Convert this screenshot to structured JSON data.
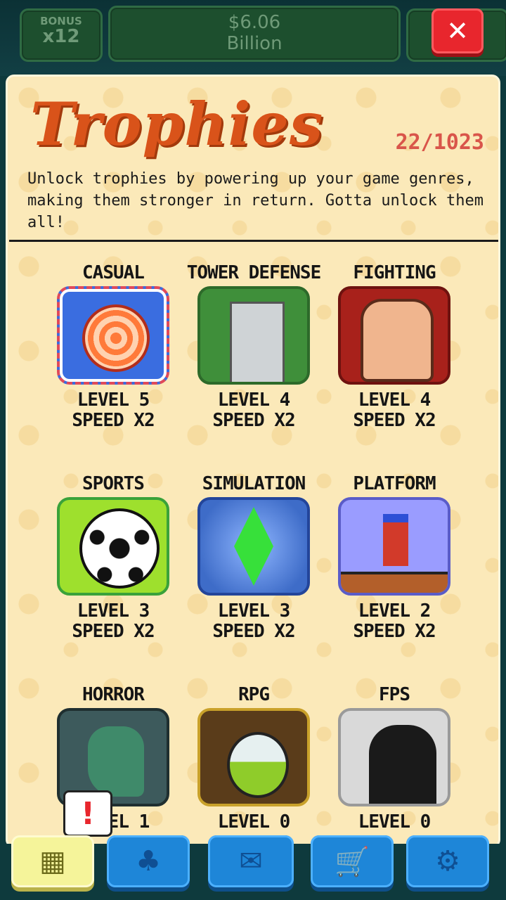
{
  "hud": {
    "bonus_label": "BONUS",
    "bonus_value": "x12",
    "money_amount": "$6.06",
    "money_unit": "Billion",
    "close_label": "✕"
  },
  "panel": {
    "title": "Trophies",
    "count": "22/1023",
    "description": "Unlock trophies by powering up your game genres, making them stronger in return. Gotta unlock them all!"
  },
  "trophies": [
    {
      "genre": "CASUAL",
      "level": "LEVEL 5",
      "speed": "SPEED X2",
      "icon": "candy-icon"
    },
    {
      "genre": "TOWER DEFENSE",
      "level": "LEVEL 4",
      "speed": "SPEED X2",
      "icon": "tower-icon"
    },
    {
      "genre": "FIGHTING",
      "level": "LEVEL 4",
      "speed": "SPEED X2",
      "icon": "fist-icon"
    },
    {
      "genre": "SPORTS",
      "level": "LEVEL 3",
      "speed": "SPEED X2",
      "icon": "soccer-ball-icon"
    },
    {
      "genre": "SIMULATION",
      "level": "LEVEL 3",
      "speed": "SPEED X2",
      "icon": "green-crystal-icon"
    },
    {
      "genre": "PLATFORM",
      "level": "LEVEL 2",
      "speed": "SPEED X2",
      "icon": "platform-hero-icon"
    },
    {
      "genre": "HORROR",
      "level": "LEVEL 1",
      "speed": "",
      "icon": "zombie-hand-icon"
    },
    {
      "genre": "RPG",
      "level": "LEVEL 0",
      "speed": "",
      "icon": "potion-icon"
    },
    {
      "genre": "FPS",
      "level": "LEVEL 0",
      "speed": "",
      "icon": "soldier-silhouette-icon"
    }
  ],
  "alert": "!",
  "nav": {
    "items": [
      {
        "name": "trophies",
        "icon": "grid-icon",
        "glyph": "▦"
      },
      {
        "name": "luck",
        "icon": "clover-icon",
        "glyph": "♣"
      },
      {
        "name": "mail",
        "icon": "envelope-icon",
        "glyph": "✉"
      },
      {
        "name": "shop",
        "icon": "cart-icon",
        "glyph": "🛒"
      },
      {
        "name": "settings",
        "icon": "gear-icon",
        "glyph": "⚙"
      }
    ]
  }
}
